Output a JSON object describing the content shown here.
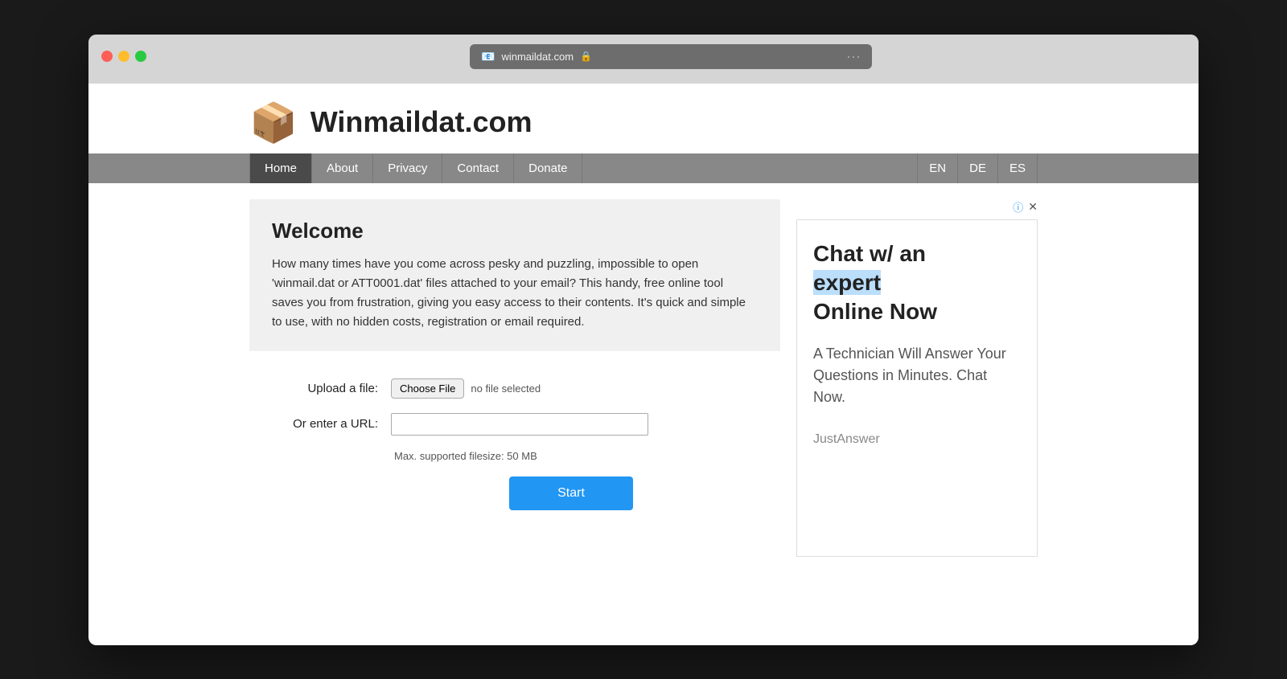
{
  "browser": {
    "address": "winmaildat.com",
    "lock_icon": "🔒",
    "favicon": "📧",
    "dots_label": "···"
  },
  "header": {
    "logo": "📦",
    "site_title": "Winmaildat.com"
  },
  "nav": {
    "items": [
      {
        "label": "Home",
        "active": true
      },
      {
        "label": "About",
        "active": false
      },
      {
        "label": "Privacy",
        "active": false
      },
      {
        "label": "Contact",
        "active": false
      },
      {
        "label": "Donate",
        "active": false
      }
    ],
    "languages": [
      "EN",
      "DE",
      "ES"
    ]
  },
  "welcome": {
    "title": "Welcome",
    "body": "How many times have you come across pesky and puzzling, impossible to open 'winmail.dat or ATT0001.dat' files attached to your email? This handy, free online tool saves you from frustration, giving you easy access to their contents. It's quick and simple to use, with no hidden costs, registration or email required."
  },
  "form": {
    "upload_label": "Upload a file:",
    "choose_file_label": "Choose File",
    "no_file_label": "no file selected",
    "url_label": "Or enter a URL:",
    "url_placeholder": "",
    "max_filesize": "Max. supported filesize: 50 MB",
    "start_label": "Start"
  },
  "ad": {
    "info_label": "ⓘ",
    "close_label": "✕",
    "headline_part1": "Chat w/ an",
    "headline_part2": "expert",
    "headline_part3": "Online Now",
    "subtext": "A Technician Will Answer Your Questions in Minutes. Chat Now.",
    "brand": "JustAnswer"
  }
}
